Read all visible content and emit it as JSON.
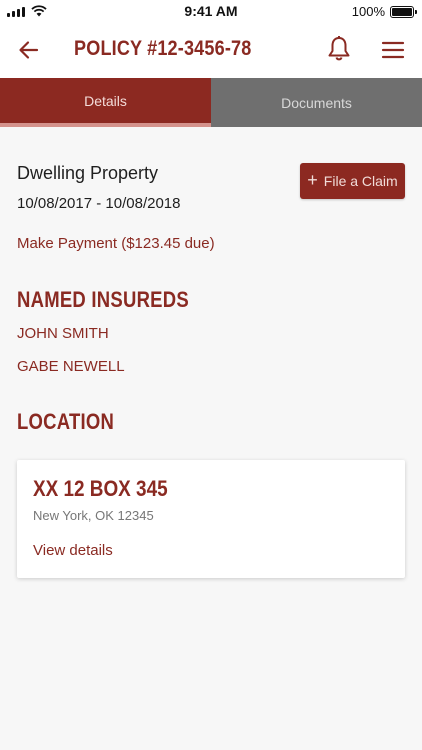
{
  "status_bar": {
    "time": "9:41 AM",
    "battery": "100%",
    "icons": [
      "signal-icon",
      "wifi-icon",
      "battery-icon"
    ]
  },
  "nav": {
    "title": "POLICY #12-3456-78",
    "icons": [
      "back-arrow-icon",
      "bell-icon",
      "hamburger-menu-icon"
    ]
  },
  "tabs": [
    {
      "label": "Details",
      "active": true
    },
    {
      "label": "Documents",
      "active": false
    }
  ],
  "policy": {
    "property_type": "Dwelling Property",
    "dates": "10/08/2017 - 10/08/2018",
    "file_claim_label": "File a Claim",
    "payment_label": "Make Payment ($123.45 due)"
  },
  "named_insureds": {
    "title": "NAMED INSUREDS",
    "items": [
      "JOHN SMITH",
      "GABE NEWELL"
    ]
  },
  "location": {
    "title": "LOCATION",
    "address": "XX 12 BOX 345",
    "city": "New York, OK 12345",
    "view_label": "View details"
  },
  "colors": {
    "brand": "#8c2921",
    "tab_inactive": "#6f6f6f",
    "background": "#f7f7f7"
  }
}
